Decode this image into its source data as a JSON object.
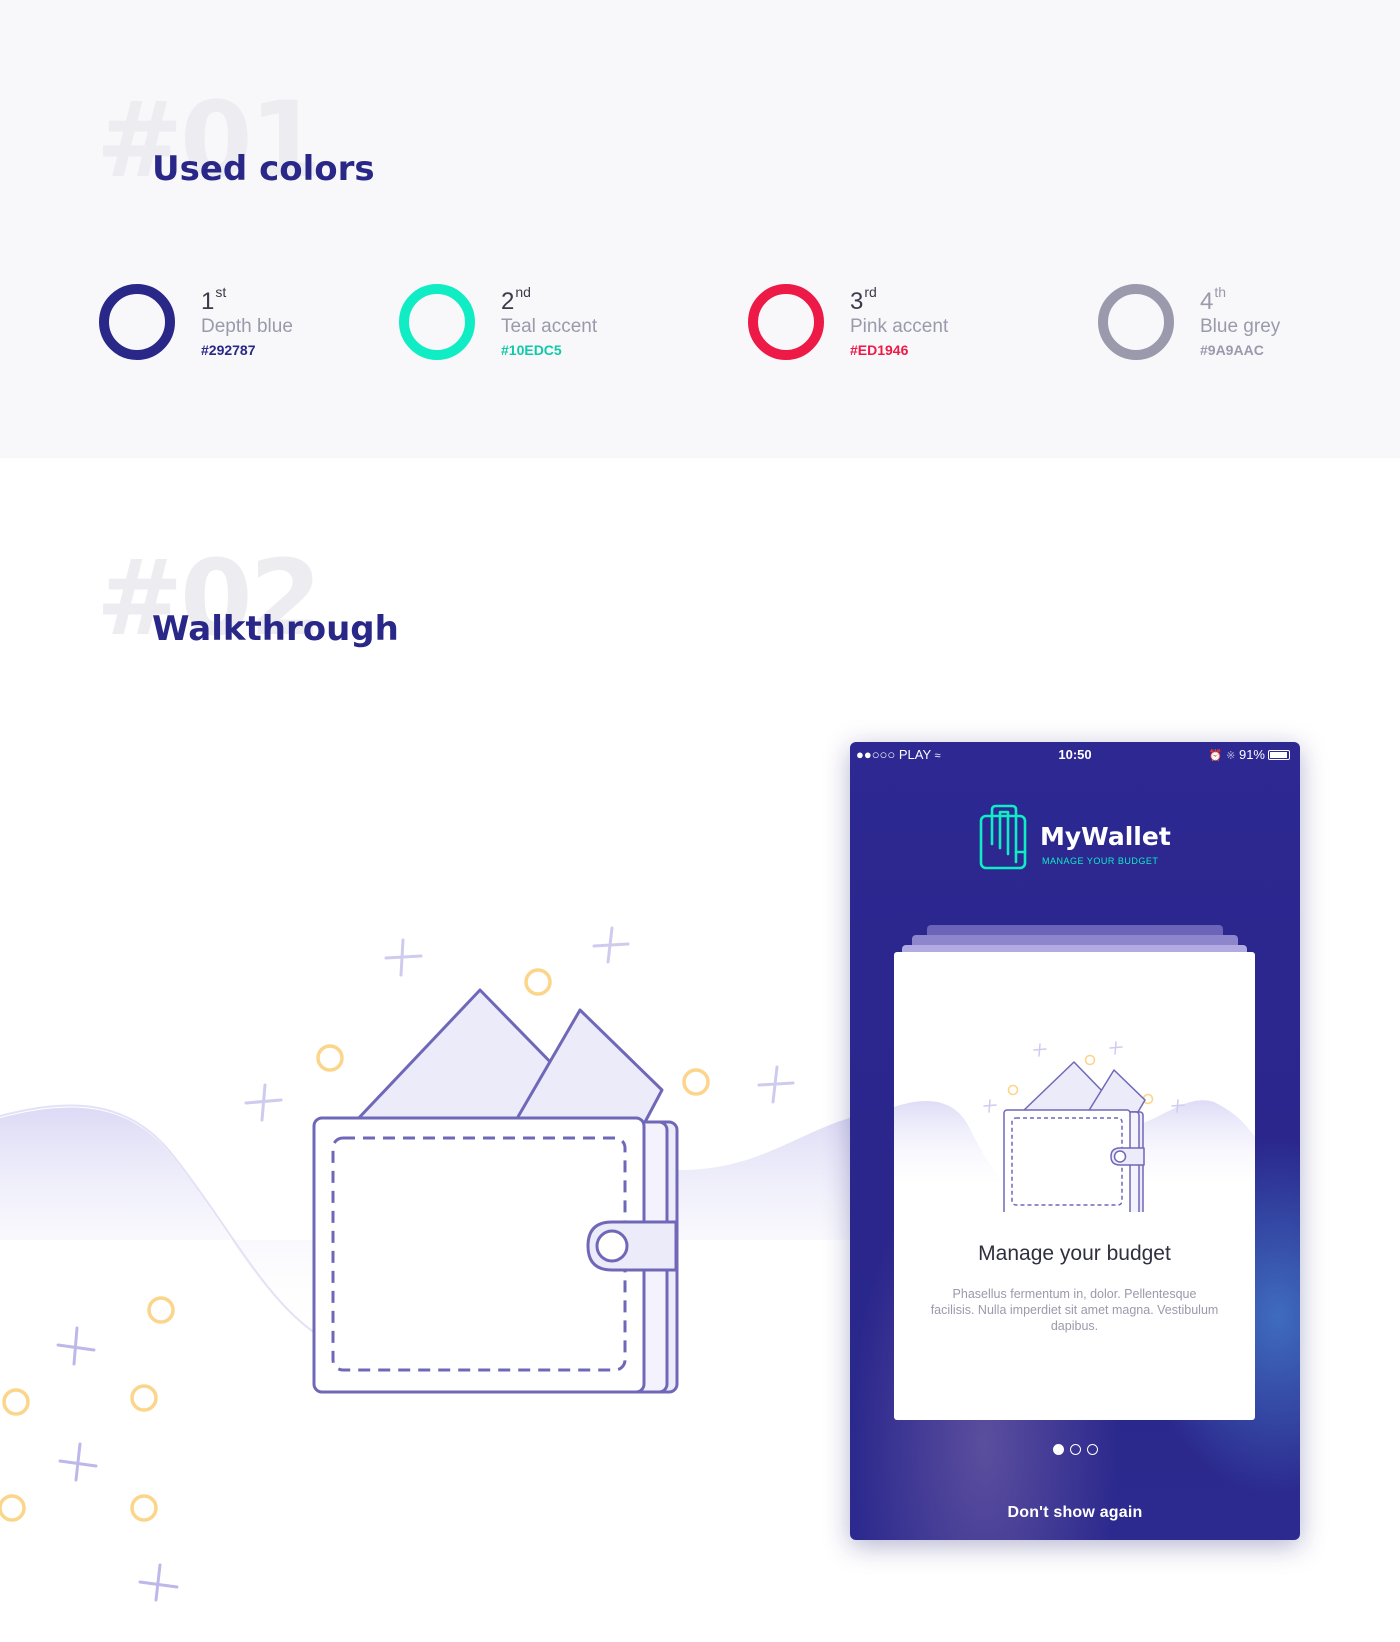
{
  "colors_section": {
    "number": "#01",
    "title": "Used colors",
    "swatches": [
      {
        "ordinal": "1",
        "suffix": "st",
        "name": "Depth blue",
        "hex": "#292787"
      },
      {
        "ordinal": "2",
        "suffix": "nd",
        "name": "Teal accent",
        "hex": "#10EDC5"
      },
      {
        "ordinal": "3",
        "suffix": "rd",
        "name": "Pink accent",
        "hex": "#ED1946"
      },
      {
        "ordinal": "4",
        "suffix": "th",
        "name": "Blue grey",
        "hex": "#9A9AAC"
      }
    ]
  },
  "walkthrough_section": {
    "number": "#02",
    "title": "Walkthrough"
  },
  "phone": {
    "status": {
      "carrier": "●●○○○ PLAY",
      "time": "10:50",
      "battery": "91%"
    },
    "app_name": "MyWallet",
    "tagline": "MANAGE YOUR BUDGET",
    "card_title": "Manage your budget",
    "card_body": "Phasellus fermentum in, dolor. Pellentesque facilisis. Nulla imperdiet sit amet magna. Vestibulum dapibus.",
    "page_indicator": {
      "current": 1,
      "total": 3
    },
    "dismiss_label": "Don't show again"
  },
  "palette": {
    "depth_blue": "#292787",
    "teal": "#10EDC5",
    "pink": "#ED1946",
    "blue_grey": "#9A9AAC",
    "wallet_stroke": "#6f68b8",
    "wallet_fill": "#ecebfa",
    "coin": "#fbd58a"
  }
}
